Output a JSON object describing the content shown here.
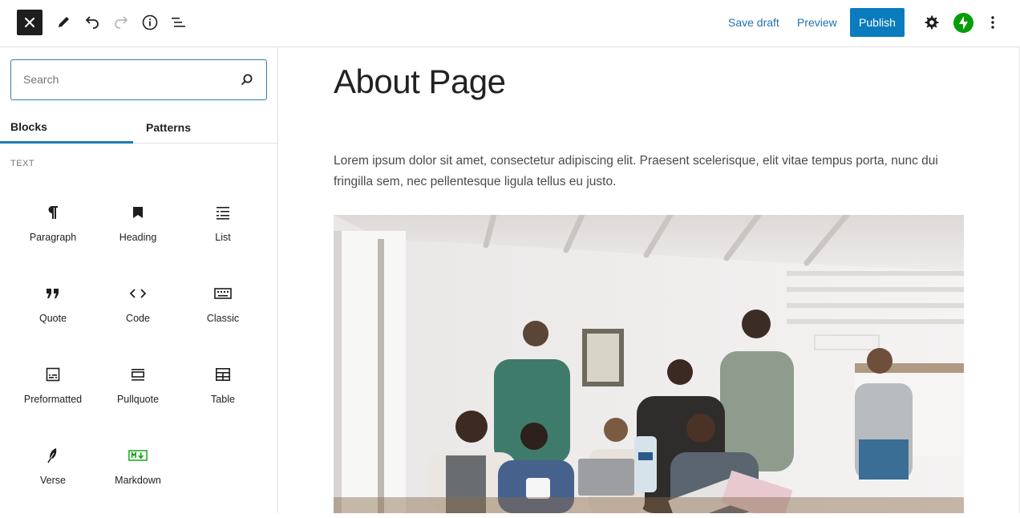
{
  "toolbar": {
    "save_draft_label": "Save draft",
    "preview_label": "Preview",
    "publish_label": "Publish"
  },
  "inserter": {
    "search_placeholder": "Search",
    "tabs": [
      {
        "label": "Blocks",
        "active": true
      },
      {
        "label": "Patterns",
        "active": false
      }
    ],
    "section_label": "TEXT",
    "blocks": [
      {
        "label": "Paragraph",
        "icon": "paragraph-icon"
      },
      {
        "label": "Heading",
        "icon": "bookmark-icon"
      },
      {
        "label": "List",
        "icon": "list-icon"
      },
      {
        "label": "Quote",
        "icon": "quote-icon"
      },
      {
        "label": "Code",
        "icon": "code-icon"
      },
      {
        "label": "Classic",
        "icon": "keyboard-icon"
      },
      {
        "label": "Preformatted",
        "icon": "preformatted-icon"
      },
      {
        "label": "Pullquote",
        "icon": "pullquote-icon"
      },
      {
        "label": "Table",
        "icon": "table-icon"
      },
      {
        "label": "Verse",
        "icon": "feather-icon"
      },
      {
        "label": "Markdown",
        "icon": "markdown-icon"
      }
    ]
  },
  "editor": {
    "title": "About Page",
    "paragraph": "Lorem ipsum dolor sit amet, consectetur adipiscing elit. Praesent scelerisque, elit vitae tempus porta, nunc dui fringilla sem, nec pellentesque ligula tellus eu justo."
  },
  "colors": {
    "accent": "#2271b1",
    "publish_bg": "#0a7cbd",
    "jetpack_green": "#069e08"
  }
}
